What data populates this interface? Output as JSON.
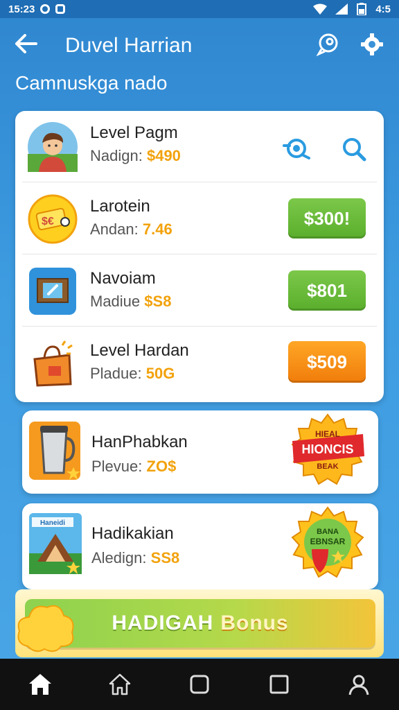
{
  "status_bar": {
    "time": "15:23",
    "battery": "4:5"
  },
  "app_bar": {
    "title": "Duvel Harrian",
    "back_icon": "arrow-left-icon",
    "action_icons": [
      "chat-icon",
      "settings-icon"
    ]
  },
  "subtitle": "Camnuskga nado",
  "list": {
    "header": {
      "name": "Level Pagm",
      "label": "Nadign:",
      "value": "$490",
      "icons": [
        "refresh-search-icon",
        "search-icon"
      ]
    },
    "items": [
      {
        "name": "Larotein",
        "label": "Andan:",
        "value": "7.46",
        "price": "$300!",
        "button_color": "#5aae2c"
      },
      {
        "name": "Navoiam",
        "label": "Madiue",
        "value": "$S8",
        "price": "$801",
        "button_color": "#5aae2c"
      },
      {
        "name": "Level Hardan",
        "label": "Pladue:",
        "value": "50G",
        "price": "$509",
        "button_color": "#f07c0a"
      }
    ]
  },
  "cards": [
    {
      "name": "HanPhabkan",
      "label": "Plevue:",
      "value": "ZO$",
      "badge_text": [
        "HIEAL",
        "HIONCIS",
        "BEAK"
      ]
    },
    {
      "name": "Hadikakian",
      "label": "Aledign:",
      "value": "SS8",
      "image_label": "Haneidi",
      "badge_text": [
        "BANA",
        "EBNSAR"
      ]
    }
  ],
  "bonus": {
    "word1": "HADIGAH",
    "word2": "Bonus"
  },
  "nav": [
    "home-icon",
    "house-outline-icon",
    "square-icon",
    "recent-icon",
    "profile-icon"
  ]
}
